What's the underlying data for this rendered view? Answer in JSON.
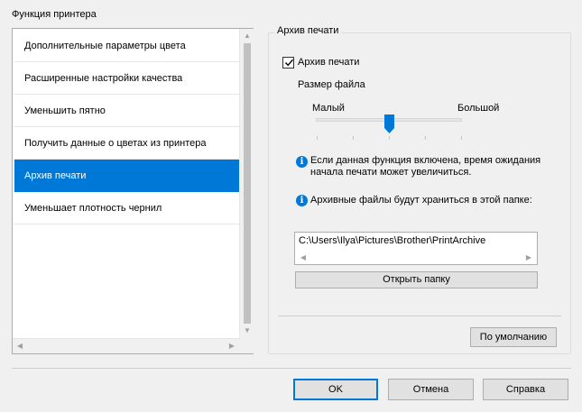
{
  "section_title": "Функция принтера",
  "feature_list": {
    "items": [
      {
        "label": "Дополнительные параметры цвета"
      },
      {
        "label": "Расширенные настройки качества"
      },
      {
        "label": "Уменьшить пятно"
      },
      {
        "label": "Получить данные о цветах из принтера"
      },
      {
        "label": "Архив печати",
        "selected": true
      },
      {
        "label": "Уменьшает плотность чернил"
      }
    ]
  },
  "archive": {
    "group_title": "Архив печати",
    "checkbox_label": "Архив печати",
    "checkbox_checked": true,
    "file_size_label": "Размер файла",
    "size_small": "Малый",
    "size_large": "Большой",
    "slider_level": 0.5,
    "info_wait": "Если данная функция включена, время ожидания начала печати может увеличиться.",
    "info_folder": "Архивные файлы будут храниться в этой папке:",
    "folder_path": "C:\\Users\\Ilya\\Pictures\\Brother\\PrintArchive",
    "open_folder_button": "Открыть папку",
    "default_button": "По умолчанию"
  },
  "footer": {
    "ok": "OK",
    "cancel": "Отмена",
    "help": "Справка"
  },
  "colors": {
    "accent": "#0078d7",
    "background": "#f0f0f0"
  },
  "icons": {
    "info": "info-icon",
    "check": "check-icon"
  }
}
